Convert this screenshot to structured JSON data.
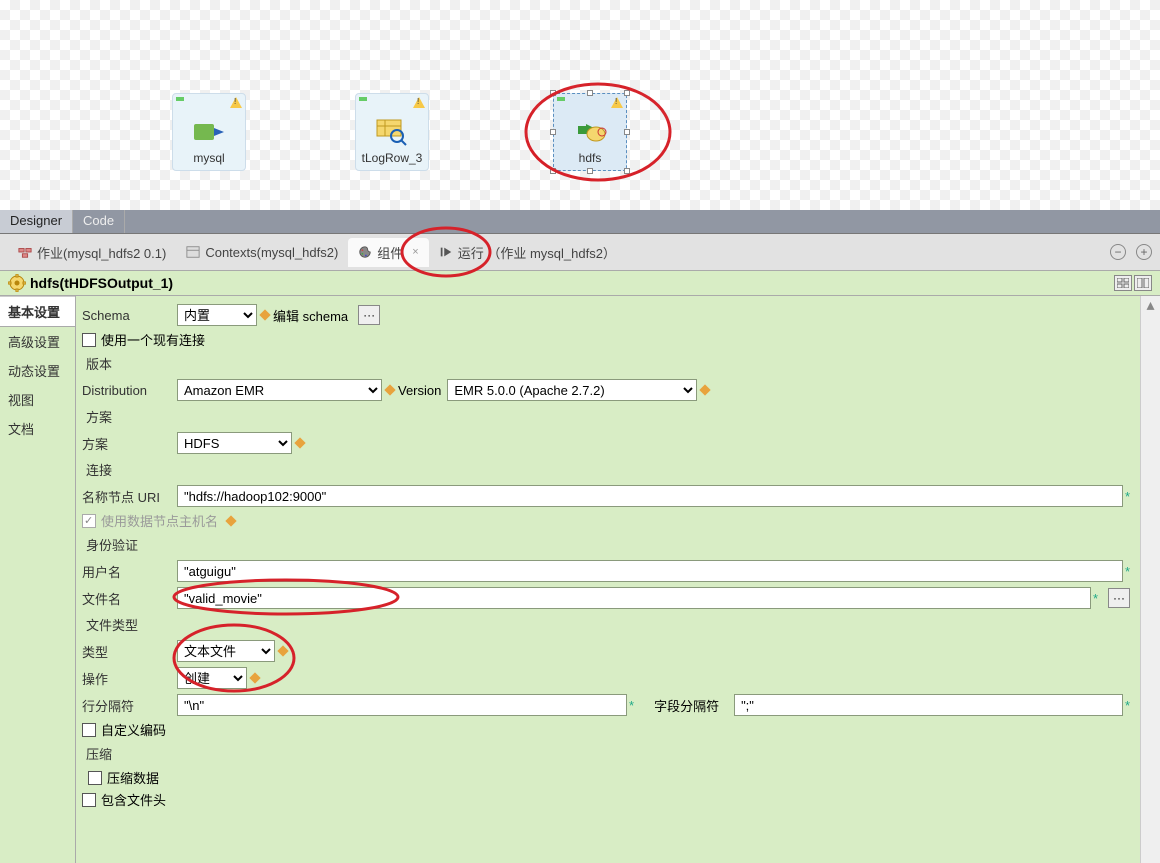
{
  "canvas": {
    "node1_label": "mysql",
    "node2_label": "tLogRow_3",
    "node3_label": "hdfs"
  },
  "top_tabs": {
    "designer": "Designer",
    "code": "Code"
  },
  "bottom_tabs": {
    "job": "作业(mysql_hdfs2 0.1)",
    "contexts": "Contexts(mysql_hdfs2)",
    "component": "组件",
    "run": "运行 （作业 mysql_hdfs2）"
  },
  "title": "hdfs(tHDFSOutput_1)",
  "side_tabs": {
    "basic": "基本设置",
    "advanced": "高级设置",
    "dynamic": "动态设置",
    "view": "视图",
    "doc": "文档"
  },
  "config": {
    "schema_label": "Schema",
    "schema_value": "内置",
    "edit_schema": "编辑 schema",
    "use_conn_label": "使用一个现有连接",
    "version_heading": "版本",
    "dist_label": "Distribution",
    "dist_value": "Amazon EMR",
    "version_label": "Version",
    "version_value": "EMR 5.0.0 (Apache 2.7.2)",
    "scheme_heading": "方案",
    "scheme_label": "方案",
    "scheme_value": "HDFS",
    "conn_heading": "连接",
    "namenode_label": "名称节点 URI",
    "namenode_value": "\"hdfs://hadoop102:9000\"",
    "use_datanode_label": "使用数据节点主机名",
    "auth_heading": "身份验证",
    "username_label": "用户名",
    "username_value": "\"atguigu\"",
    "filename_label": "文件名",
    "filename_value": "\"valid_movie\"",
    "filetype_heading": "文件类型",
    "type_label": "类型",
    "type_value": "文本文件",
    "action_label": "操作",
    "action_value": "创建",
    "rowsep_label": "行分隔符",
    "rowsep_value": "\"\\n\"",
    "fieldsep_label": "字段分隔符",
    "fieldsep_value": "\";\"",
    "custom_encoding": "自定义编码",
    "compress_heading": "压缩",
    "compress_data": "压缩数据",
    "include_header": "包含文件头"
  }
}
